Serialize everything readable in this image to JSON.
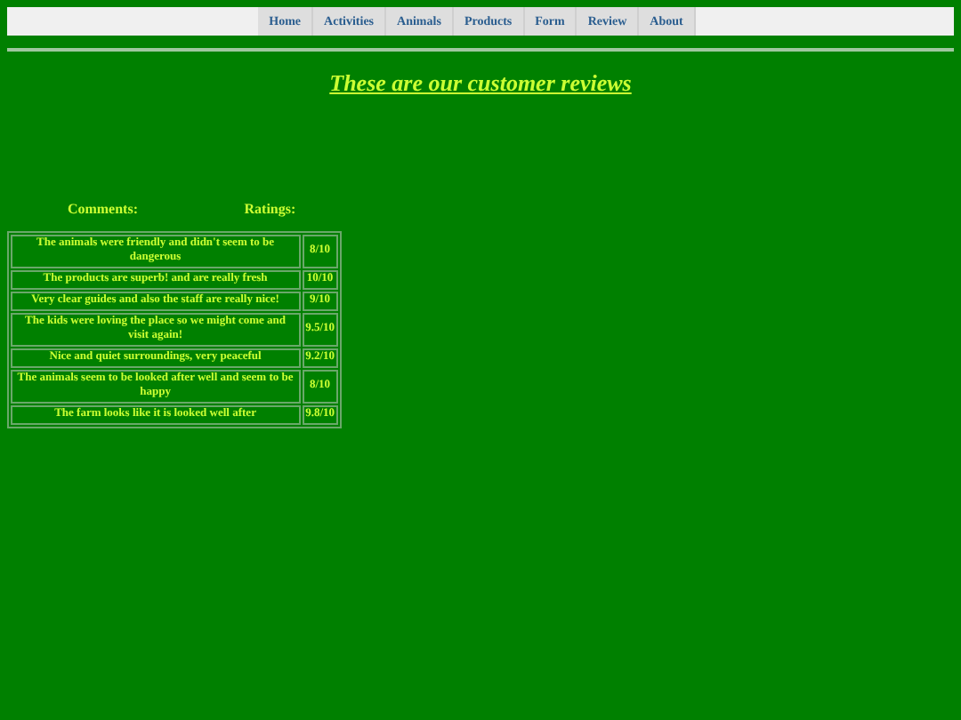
{
  "nav": [
    {
      "label": "Home"
    },
    {
      "label": "Activities"
    },
    {
      "label": "Animals"
    },
    {
      "label": "Products"
    },
    {
      "label": "Form"
    },
    {
      "label": "Review"
    },
    {
      "label": "About"
    }
  ],
  "title": "These are our customer reviews",
  "headings": [
    "Comments:",
    "Ratings:"
  ],
  "reviews": [
    {
      "comment": "The animals were friendly and didn't seem to be dangerous",
      "rating": "8/10"
    },
    {
      "comment": "The products are superb! and are really fresh",
      "rating": "10/10"
    },
    {
      "comment": "Very clear guides and also the staff are really nice!",
      "rating": "9/10"
    },
    {
      "comment": "The kids were loving the place so we might come and visit again!",
      "rating": "9.5/10"
    },
    {
      "comment": "Nice and quiet surroundings, very peaceful",
      "rating": "9.2/10"
    },
    {
      "comment": "The animals seem to be looked after well and seem to be happy",
      "rating": "8/10"
    },
    {
      "comment": "The farm looks like it is looked well after",
      "rating": "9.8/10"
    }
  ]
}
